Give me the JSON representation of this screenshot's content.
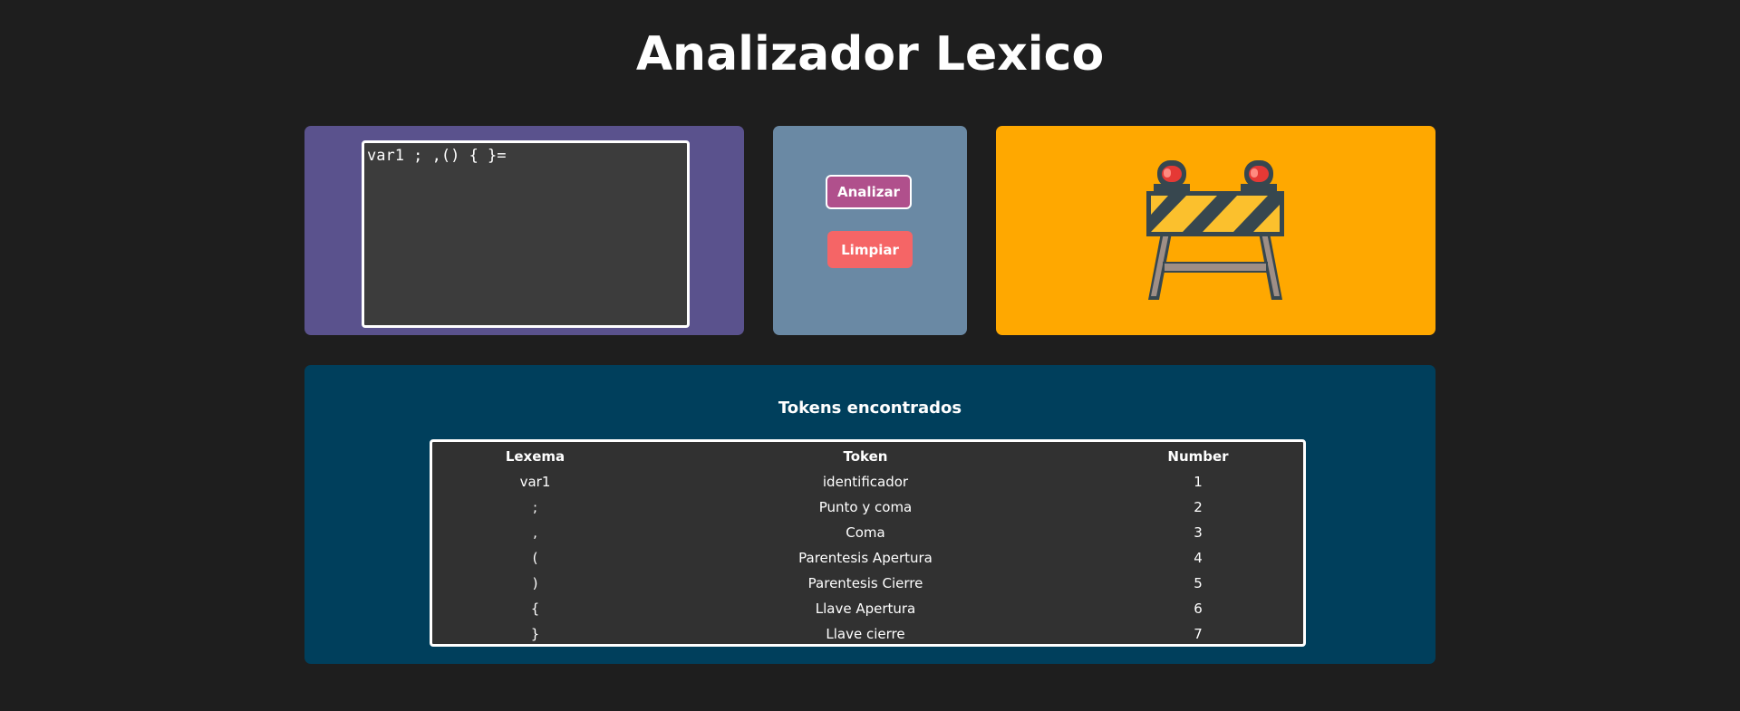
{
  "page": {
    "title": "Analizador Lexico"
  },
  "editor": {
    "code": "var1 ; ,() { }="
  },
  "actions": {
    "analyze_label": "Analizar",
    "clear_label": "Limpiar"
  },
  "image_panel": {
    "icon": "road-barrier-icon"
  },
  "results": {
    "title": "Tokens encontrados",
    "columns": [
      "Lexema",
      "Token",
      "Number"
    ],
    "rows": [
      {
        "lexema": "var1",
        "token": "identificador",
        "number": "1"
      },
      {
        "lexema": ";",
        "token": "Punto y coma",
        "number": "2"
      },
      {
        "lexema": ",",
        "token": "Coma",
        "number": "3"
      },
      {
        "lexema": "(",
        "token": "Parentesis Apertura",
        "number": "4"
      },
      {
        "lexema": ")",
        "token": "Parentesis Cierre",
        "number": "5"
      },
      {
        "lexema": "{",
        "token": "Llave Apertura",
        "number": "6"
      },
      {
        "lexema": "}",
        "token": "Llave cierre",
        "number": "7"
      }
    ]
  },
  "colors": {
    "background": "#1e1e1e",
    "editor_panel": "#5a528d",
    "actions_panel": "#6a89a4",
    "image_panel": "#ffa800",
    "results_panel": "#003f5c",
    "analyze_button": "#b0508c",
    "clear_button": "#f56566"
  }
}
